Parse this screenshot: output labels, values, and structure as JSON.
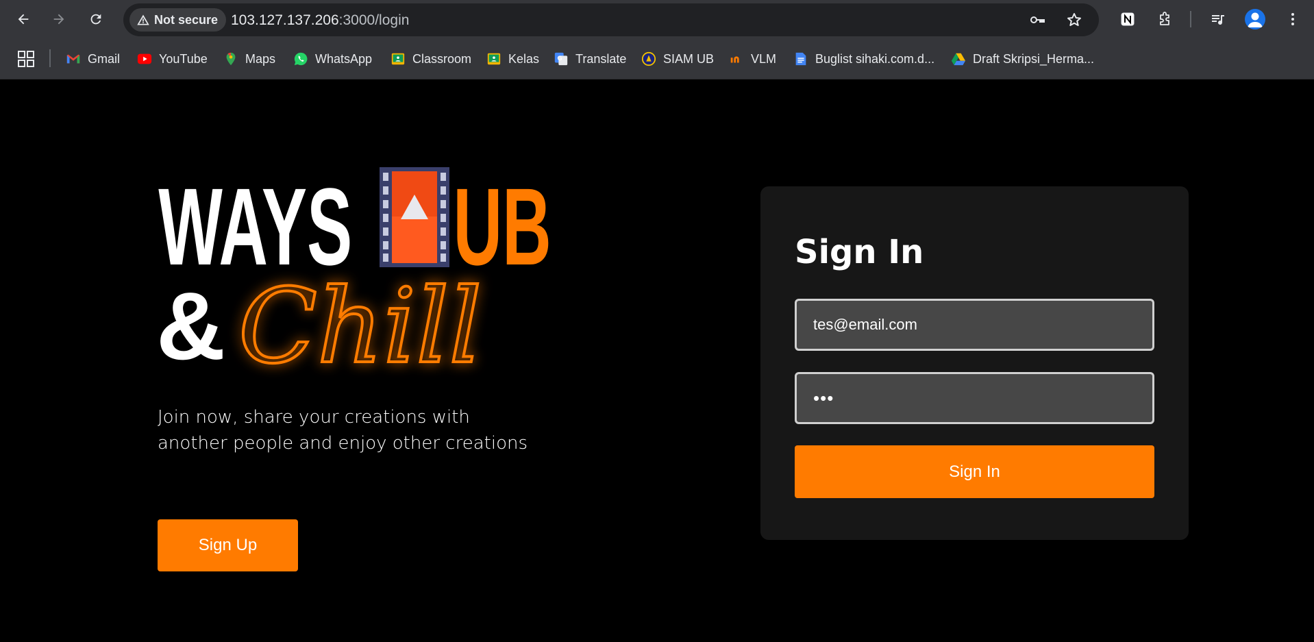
{
  "browser": {
    "security_label": "Not secure",
    "url_host": "103.127.137.206",
    "url_path": ":3000/login",
    "nav": {
      "back_icon": "arrow-left-icon",
      "forward_icon": "arrow-right-icon",
      "reload_icon": "reload-icon"
    },
    "toolbar_icons": [
      "key-icon",
      "star-icon",
      "notion-icon",
      "extensions-icon",
      "media-icon",
      "profile-icon",
      "more-icon"
    ]
  },
  "bookmarks": [
    {
      "label": "Gmail",
      "icon": "gmail-icon",
      "color": "#ea4335"
    },
    {
      "label": "YouTube",
      "icon": "youtube-icon",
      "color": "#ff0000"
    },
    {
      "label": "Maps",
      "icon": "maps-icon",
      "color": "#34a853"
    },
    {
      "label": "WhatsApp",
      "icon": "whatsapp-icon",
      "color": "#25d366"
    },
    {
      "label": "Classroom",
      "icon": "classroom-icon",
      "color": "#f4b400"
    },
    {
      "label": "Kelas",
      "icon": "classroom-icon",
      "color": "#f4b400"
    },
    {
      "label": "Translate",
      "icon": "translate-icon",
      "color": "#4285f4"
    },
    {
      "label": "SIAM UB",
      "icon": "siam-icon",
      "color": "#f2c200"
    },
    {
      "label": "VLM",
      "icon": "vlm-icon",
      "color": "#ff7b00"
    },
    {
      "label": "Buglist sihaki.com.d...",
      "icon": "docs-icon",
      "color": "#4285f4"
    },
    {
      "label": "Draft Skripsi_Herma...",
      "icon": "drive-icon",
      "color": "#0f9d58"
    }
  ],
  "logo": {
    "word1": "WAYS",
    "word2": "UB",
    "word3": "&",
    "word4": "Chill",
    "accent": "#ff7b00"
  },
  "hero": {
    "tagline": "Join now, share your creations with another people and enjoy other creations",
    "signup_label": "Sign Up"
  },
  "signin": {
    "title": "Sign In",
    "email_value": "tes@email.com",
    "password_value": "•••",
    "button_label": "Sign In"
  },
  "colors": {
    "accent": "#ff7b00",
    "card_bg": "#171717",
    "field_bg": "#474747"
  }
}
